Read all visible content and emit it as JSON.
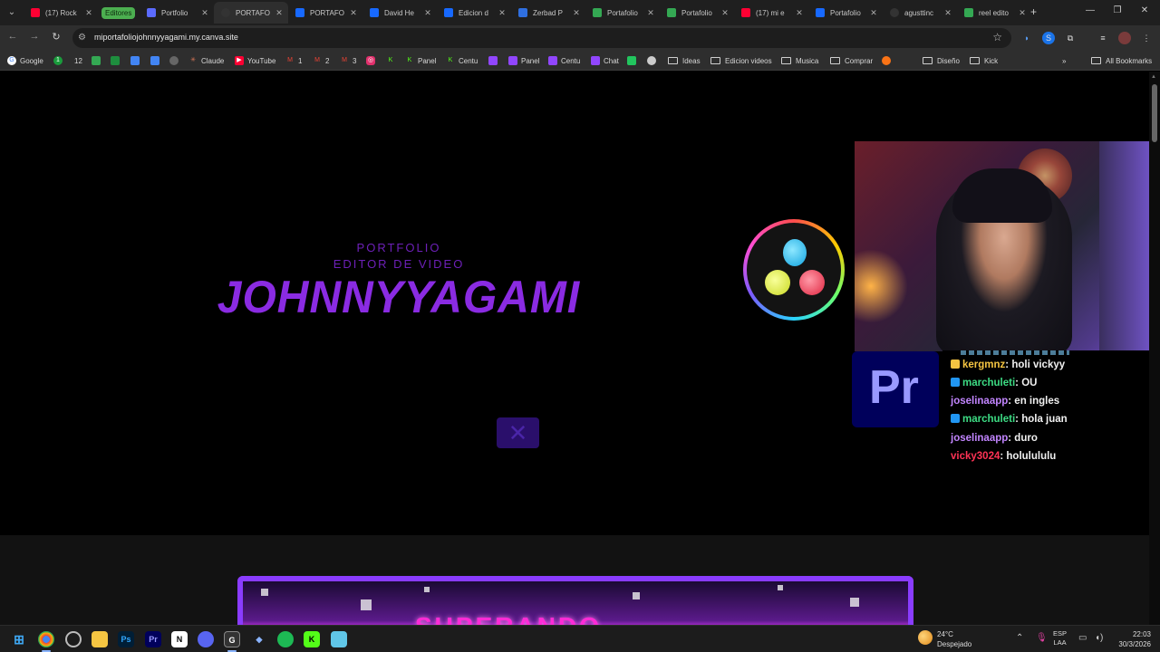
{
  "browser": {
    "tabs": [
      {
        "title": "(17) Rock",
        "favicon": "youtube-icon",
        "color": "#ff0033"
      },
      {
        "title": "Portfolio",
        "favicon": "canva-play-icon",
        "color": "#5b6bff"
      },
      {
        "title": "PORTAFO",
        "favicon": "canva-icon",
        "color": "#222222",
        "active": true
      },
      {
        "title": "PORTAFO",
        "favicon": "behance-icon",
        "color": "#1769ff"
      },
      {
        "title": "David He",
        "favicon": "behance-icon",
        "color": "#1769ff"
      },
      {
        "title": "Edicion d",
        "favicon": "behance-icon",
        "color": "#1769ff"
      },
      {
        "title": "Zerbad P",
        "favicon": "checkbox-icon",
        "color": "#2f6fe0"
      },
      {
        "title": "Portafolio",
        "favicon": "drive-icon",
        "color": "#34a853"
      },
      {
        "title": "Portafolio",
        "favicon": "drive-icon",
        "color": "#34a853"
      },
      {
        "title": "(17) mi e",
        "favicon": "youtube-icon",
        "color": "#ff0033"
      },
      {
        "title": "Portafolio",
        "favicon": "behance-icon",
        "color": "#1769ff"
      },
      {
        "title": "agusttinc",
        "favicon": "globe-icon",
        "color": "#333333"
      },
      {
        "title": "reel edito",
        "favicon": "drive-icon",
        "color": "#34a853"
      }
    ],
    "tab_group_label": "Editores",
    "address": "miportafoliojohnnyyagami.my.canva.site",
    "bookmarks": [
      {
        "label": "Google",
        "icon": "google-icon",
        "color": "#4285f4"
      },
      {
        "label": "",
        "icon": "number-icon",
        "color": "#1a9c3c"
      },
      {
        "label": "12",
        "icon": "",
        "color": ""
      },
      {
        "label": "",
        "icon": "drive-icon",
        "color": "#34a853"
      },
      {
        "label": "",
        "icon": "sheets-icon",
        "color": "#1e8e3e"
      },
      {
        "label": "",
        "icon": "docs-icon",
        "color": "#4285f4"
      },
      {
        "label": "",
        "icon": "calendar-icon",
        "color": "#4285f4"
      },
      {
        "label": "",
        "icon": "camera-icon",
        "color": "#666666"
      },
      {
        "label": "Claude",
        "icon": "claude-icon",
        "color": "#d97757"
      },
      {
        "label": "YouTube",
        "icon": "youtube-icon",
        "color": "#ff0033"
      },
      {
        "label": "1",
        "icon": "gmail-icon",
        "color": "#ea4335"
      },
      {
        "label": "2",
        "icon": "gmail-icon",
        "color": "#ea4335"
      },
      {
        "label": "3",
        "icon": "gmail-icon",
        "color": "#ea4335"
      },
      {
        "label": "",
        "icon": "instagram-icon",
        "color": "#e1306c"
      },
      {
        "label": "",
        "icon": "kick-icon",
        "color": "#53fc18"
      },
      {
        "label": "Panel",
        "icon": "kick-icon",
        "color": "#53fc18"
      },
      {
        "label": "Centu",
        "icon": "kick-icon",
        "color": "#53fc18"
      },
      {
        "label": "",
        "icon": "twitch-icon",
        "color": "#9146ff"
      },
      {
        "label": "Panel",
        "icon": "twitch-icon",
        "color": "#9146ff"
      },
      {
        "label": "Centu",
        "icon": "twitch-icon",
        "color": "#9146ff"
      },
      {
        "label": "Chat",
        "icon": "twitch-icon",
        "color": "#9146ff"
      },
      {
        "label": "",
        "icon": "tool-icon",
        "color": "#22c55e"
      },
      {
        "label": "",
        "icon": "github-icon",
        "color": "#cccccc"
      },
      {
        "label": "Ideas",
        "icon": "folder-icon",
        "color": ""
      },
      {
        "label": "Edicion videos",
        "icon": "folder-icon",
        "color": ""
      },
      {
        "label": "Musica",
        "icon": "folder-icon",
        "color": ""
      },
      {
        "label": "Comprar",
        "icon": "folder-icon",
        "color": ""
      },
      {
        "label": "",
        "icon": "fox-icon",
        "color": "#f97316"
      },
      {
        "label": "Diseño",
        "icon": "folder-icon",
        "color": ""
      },
      {
        "label": "Kick",
        "icon": "folder-icon",
        "color": ""
      }
    ],
    "all_bookmarks": "All Bookmarks"
  },
  "page": {
    "subtitle1": "PORTFOLIO",
    "subtitle2": "EDITOR DE VIDEO",
    "name": "JOHNNYYAGAMI",
    "banner_title": "SUPERANDO",
    "accent": "#8a2be2"
  },
  "chat": {
    "messages": [
      {
        "user": "kergmnz",
        "text": ": holi vickyy",
        "color": "#f5c542",
        "badge": "crown-badge",
        "badge_color": "#f5c542"
      },
      {
        "user": "marchuleti",
        "text": ": OU",
        "color": "#3ddc84",
        "badge": "sub-badge",
        "badge_color": "#2196f3"
      },
      {
        "user": "joselinaapp",
        "text": ": en ingles",
        "color": "#c285ff",
        "badge": "",
        "badge_color": ""
      },
      {
        "user": "marchuleti",
        "text": ": hola juan",
        "color": "#3ddc84",
        "badge": "sub-badge",
        "badge_color": "#2196f3"
      },
      {
        "user": "joselinaapp",
        "text": ": duro",
        "color": "#c285ff",
        "badge": "",
        "badge_color": ""
      },
      {
        "user": "vicky3024",
        "text": ": holulululu",
        "color": "#ff3355",
        "badge": "",
        "badge_color": ""
      }
    ]
  },
  "taskbar": {
    "weather_temp": "24°C",
    "weather_desc": "Despejado",
    "lang_top": "ESP",
    "lang_bottom": "LAA",
    "time": "22:03",
    "date": "30/3/2026"
  }
}
